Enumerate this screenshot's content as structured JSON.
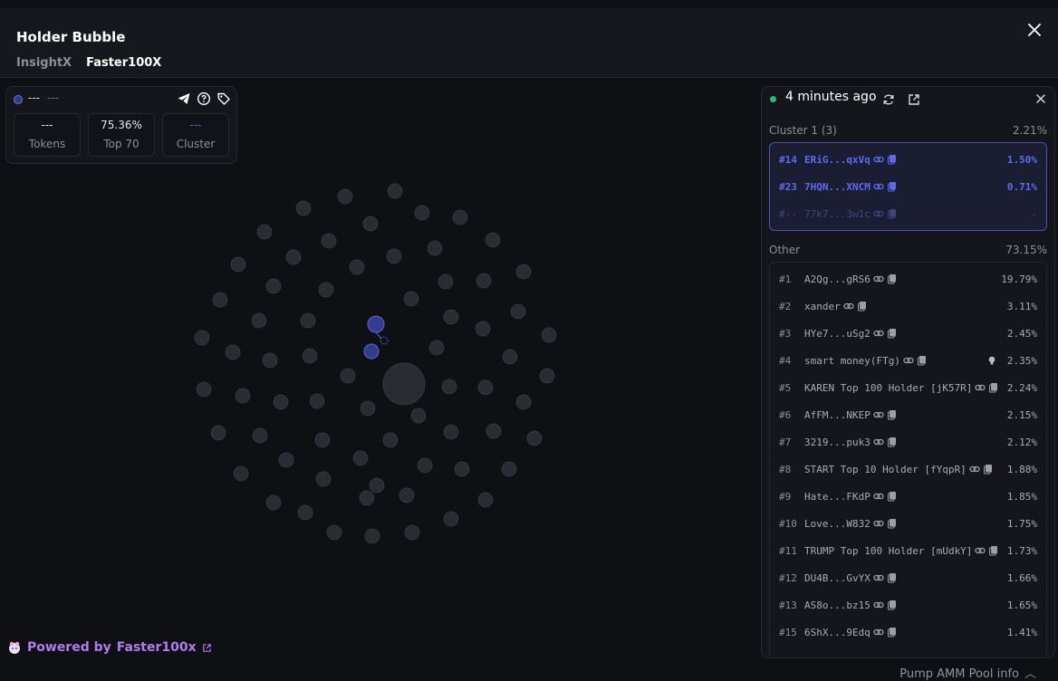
{
  "modal": {
    "title": "Holder Bubble",
    "tabs": [
      {
        "label": "InsightX",
        "active": false
      },
      {
        "label": "Faster100X",
        "active": true
      }
    ]
  },
  "info_card": {
    "name": "---",
    "sub": "---",
    "stats": [
      {
        "value": "---",
        "label": "Tokens"
      },
      {
        "value": "75.36%",
        "label": "Top 70"
      },
      {
        "value": "---",
        "label": "Cluster"
      }
    ]
  },
  "powered_by": {
    "prefix": "Powered by",
    "brand": "Faster100x"
  },
  "panel": {
    "updated": "4 minutes ago",
    "cluster": {
      "label": "Cluster 1 (3)",
      "percent": "2.21%",
      "rows": [
        {
          "rank": "#14",
          "name": "ERiG...qxVq",
          "percent": "1.50%",
          "dim": false
        },
        {
          "rank": "#23",
          "name": "7HQN...XNCM",
          "percent": "0.71%",
          "dim": false
        },
        {
          "rank": "#--",
          "name": "77k7...3w1c",
          "percent": "-",
          "dim": true
        }
      ]
    },
    "other": {
      "label": "Other",
      "percent": "73.15%",
      "rows": [
        {
          "rank": "#1",
          "name": "A2Qg...gRS6",
          "percent": "19.79%"
        },
        {
          "rank": "#2",
          "name": "xander",
          "percent": "3.11%"
        },
        {
          "rank": "#3",
          "name": "HYe7...uSg2",
          "percent": "2.45%"
        },
        {
          "rank": "#4",
          "name": "smart money(FTg)",
          "percent": "2.35%",
          "bulb": true
        },
        {
          "rank": "#5",
          "name": "KAREN Top 100 Holder [jK57R]",
          "percent": "2.24%"
        },
        {
          "rank": "#6",
          "name": "AfFM...NKEP",
          "percent": "2.15%"
        },
        {
          "rank": "#7",
          "name": "3219...puk3",
          "percent": "2.12%"
        },
        {
          "rank": "#8",
          "name": "START Top 10 Holder [fYqpR]",
          "percent": "1.88%"
        },
        {
          "rank": "#9",
          "name": "Hate...FKdP",
          "percent": "1.85%"
        },
        {
          "rank": "#10",
          "name": "Love...W832",
          "percent": "1.75%"
        },
        {
          "rank": "#11",
          "name": "TRUMP Top 100 Holder [mUdkY]",
          "percent": "1.73%"
        },
        {
          "rank": "#12",
          "name": "DU4B...GvYX",
          "percent": "1.66%"
        },
        {
          "rank": "#13",
          "name": "AS8o...bz15",
          "percent": "1.65%"
        },
        {
          "rank": "#15",
          "name": "6ShX...9Edq",
          "percent": "1.41%"
        }
      ]
    }
  },
  "footer": {
    "pool_info": "Pump AMM Pool info"
  },
  "colors": {
    "cluster_accent": "#5b6cf0",
    "bubble_fill": "#2a2c33",
    "cluster_bubble_fill": "#333c8f",
    "live_dot": "#1fbf75",
    "brand_purple": "#b27cf0"
  }
}
